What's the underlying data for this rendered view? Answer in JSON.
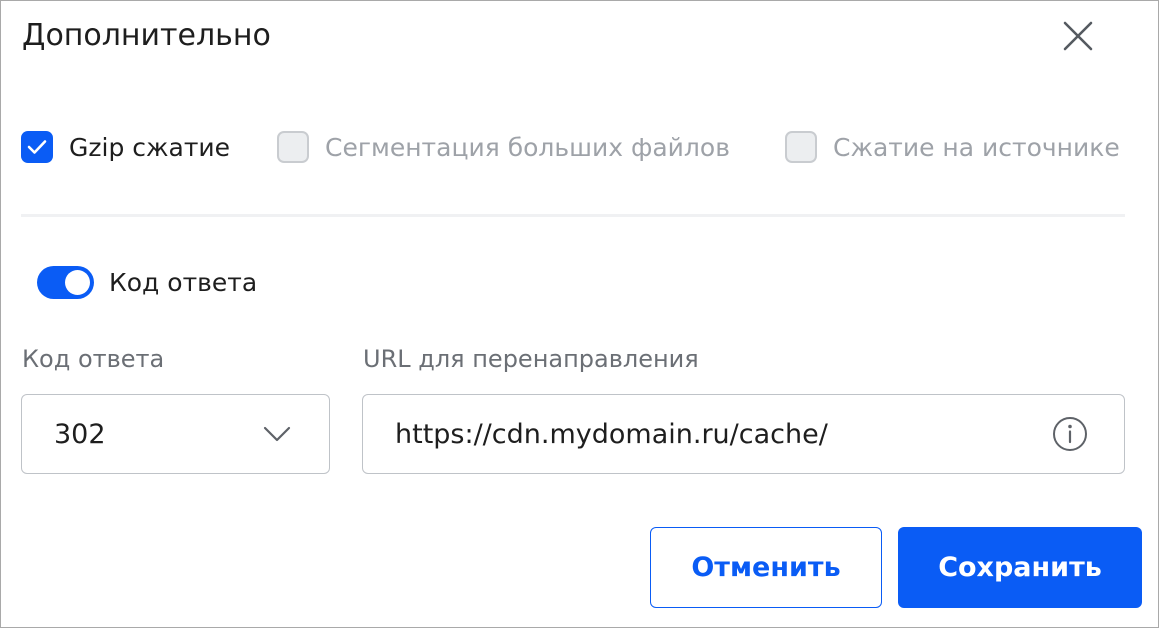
{
  "dialog": {
    "title": "Дополнительно",
    "close_icon": "close-icon"
  },
  "options": {
    "gzip": {
      "label": "Gzip сжатие",
      "checked": true,
      "enabled": true
    },
    "segmentation": {
      "label": "Сегментация больших файлов",
      "checked": false,
      "enabled": false
    },
    "origin_compression": {
      "label": "Сжатие на источнике",
      "checked": false,
      "enabled": false
    }
  },
  "response_code_toggle": {
    "label": "Код ответа",
    "on": true
  },
  "fields": {
    "response_code": {
      "label": "Код ответа",
      "value": "302",
      "icon": "chevron-down-icon"
    },
    "redirect_url": {
      "label": "URL для перенаправления",
      "value": "https://cdn.mydomain.ru/cache/",
      "icon": "info-icon"
    }
  },
  "buttons": {
    "cancel": "Отменить",
    "save": "Сохранить"
  },
  "colors": {
    "accent": "#0a5cf5",
    "disabled_text": "#9ea2a8",
    "border": "#bfc3c8"
  }
}
